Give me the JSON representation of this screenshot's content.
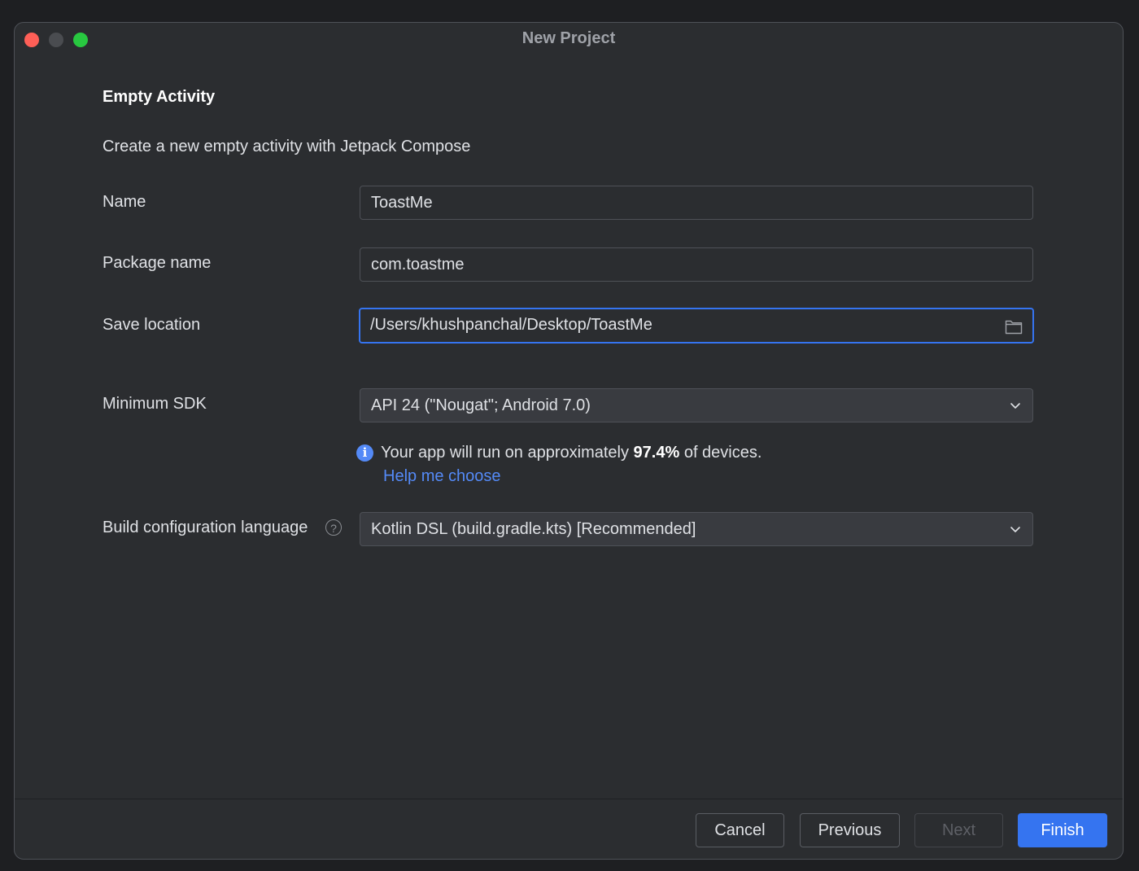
{
  "window": {
    "title": "New Project"
  },
  "form": {
    "heading": "Empty Activity",
    "description": "Create a new empty activity with Jetpack Compose",
    "name": {
      "label": "Name",
      "value": "ToastMe"
    },
    "package": {
      "label": "Package name",
      "value": "com.toastme"
    },
    "location": {
      "label": "Save location",
      "value": "/Users/khushpanchal/Desktop/ToastMe",
      "icon": "folder-icon"
    },
    "min_sdk": {
      "label": "Minimum SDK",
      "selected": "API 24 (\"Nougat\"; Android 7.0)",
      "icon": "chevron-down-icon"
    },
    "info": {
      "prefix": "Your app will run on approximately ",
      "percent": "97.4%",
      "suffix": " of devices.",
      "help_link": "Help me choose",
      "icon": "info-icon"
    },
    "build_lang": {
      "label": "Build configuration language",
      "help_icon_glyph": "?",
      "selected": "Kotlin DSL (build.gradle.kts) [Recommended]",
      "icon": "chevron-down-icon"
    }
  },
  "footer": {
    "cancel": "Cancel",
    "previous": "Previous",
    "next": "Next",
    "finish": "Finish"
  },
  "colors": {
    "accent": "#3574f0",
    "link": "#548af7",
    "close": "#fe5f57",
    "maximize": "#28c840",
    "background": "#2b2d30"
  }
}
